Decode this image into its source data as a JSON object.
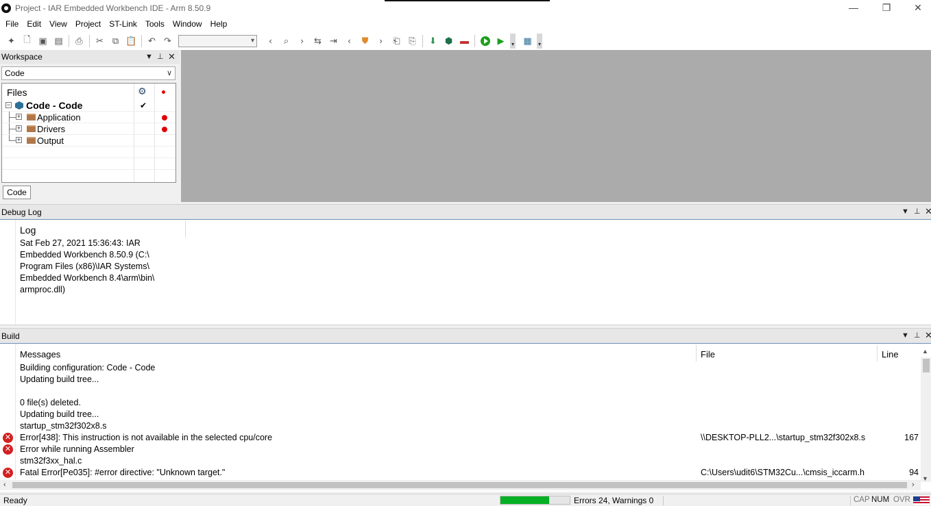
{
  "window": {
    "title": "Project - IAR Embedded Workbench IDE - Arm 8.50.9",
    "minimize": "—",
    "restore": "❐",
    "close": "✕"
  },
  "menu": [
    "File",
    "Edit",
    "View",
    "Project",
    "ST-Link",
    "Tools",
    "Window",
    "Help"
  ],
  "workspace": {
    "title": "Workspace",
    "config": "Code",
    "files_header": "Files",
    "project": "Code - Code",
    "groups": [
      {
        "name": "Application",
        "has_dot": true
      },
      {
        "name": "Drivers",
        "has_dot": true
      },
      {
        "name": "Output",
        "has_dot": false
      }
    ],
    "tab": "Code"
  },
  "debug_log": {
    "title": "Debug Log",
    "column": "Log",
    "lines": [
      "Sat Feb 27, 2021 15:36:43: IAR",
      "Embedded Workbench 8.50.9 (C:\\",
      "Program Files (x86)\\IAR Systems\\",
      "Embedded Workbench 8.4\\arm\\bin\\",
      "armproc.dll)"
    ]
  },
  "build": {
    "title": "Build",
    "columns": {
      "messages": "Messages",
      "file": "File",
      "line": "Line"
    },
    "rows": [
      {
        "msg": "Building configuration: Code - Code",
        "file": "",
        "line": "",
        "error": false
      },
      {
        "msg": "Updating build tree...",
        "file": "",
        "line": "",
        "error": false
      },
      {
        "msg": "",
        "file": "",
        "line": "",
        "error": false
      },
      {
        "msg": "0  file(s) deleted.",
        "file": "",
        "line": "",
        "error": false
      },
      {
        "msg": "Updating build tree...",
        "file": "",
        "line": "",
        "error": false
      },
      {
        "msg": "startup_stm32f302x8.s",
        "file": "",
        "line": "",
        "error": false
      },
      {
        "msg": "Error[438]: This instruction is not available in the selected cpu/core",
        "file": "\\\\DESKTOP-PLL2...\\startup_stm32f302x8.s",
        "line": "167",
        "error": true
      },
      {
        "msg": "Error while running Assembler",
        "file": "",
        "line": "",
        "error": true
      },
      {
        "msg": "stm32f3xx_hal.c",
        "file": "",
        "line": "",
        "error": false
      },
      {
        "msg": "Fatal Error[Pe035]: #error directive: \"Unknown target.\"",
        "file": "C:\\Users\\udit6\\STM32Cu...\\cmsis_iccarm.h",
        "line": "94",
        "error": true
      }
    ]
  },
  "status": {
    "ready": "Ready",
    "progress": 0.7,
    "errors": "Errors 24, Warnings 0",
    "cap": "CAP",
    "num": "NUM",
    "ovr": "OVR"
  },
  "colors": {
    "error": "#d42020",
    "progress": "#06b025",
    "editor_bg": "#ababab"
  }
}
